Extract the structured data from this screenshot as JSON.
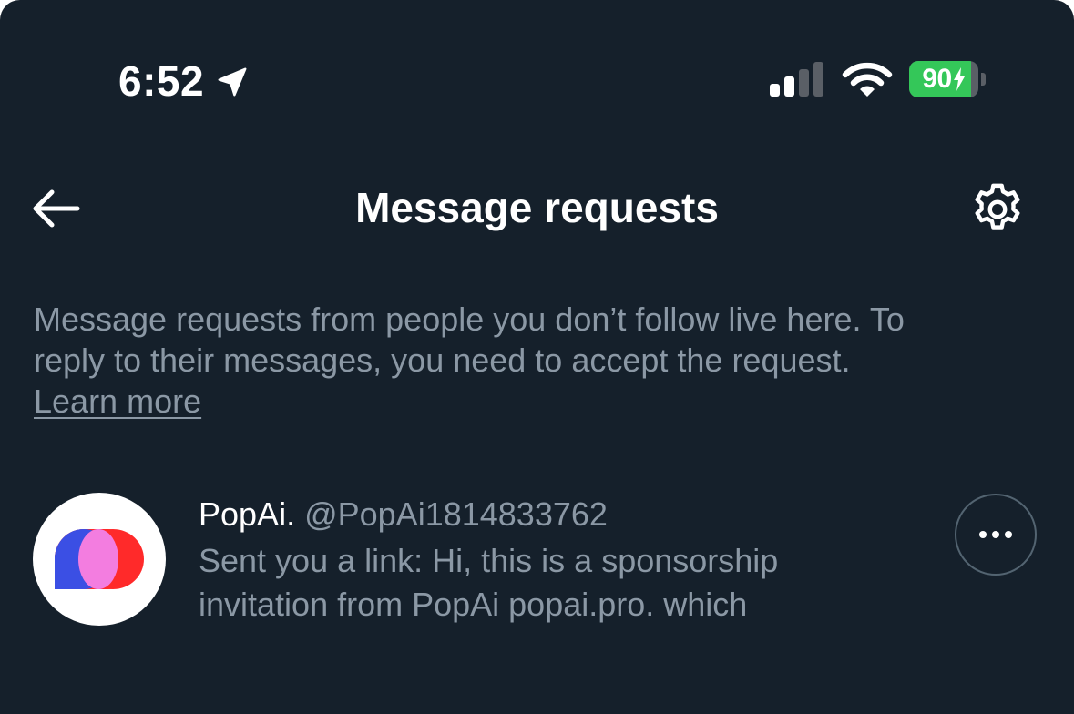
{
  "status_bar": {
    "time": "6:52",
    "battery_percent": "90",
    "battery_level": 0.9,
    "icons": [
      "location-arrow-icon",
      "cellular-signal-icon",
      "wifi-icon",
      "charging-bolt-icon"
    ]
  },
  "header": {
    "title": "Message requests",
    "back_icon": "arrow-left-icon",
    "settings_icon": "gear-icon"
  },
  "info": {
    "line1": "Message requests from people you don’t follow live here. To",
    "line2": "reply to their messages, you need to accept the request.",
    "link": "Learn more"
  },
  "requests": [
    {
      "name": "PopAi.",
      "handle": "@PopAi1814833762",
      "preview_line1": "Sent you a link: Hi, this is a sponsorship",
      "preview_line2": "invitation from PopAi popai.pro. which",
      "more_icon": "ellipsis-icon"
    }
  ],
  "colors": {
    "background": "#15202b",
    "text_primary": "#ffffff",
    "text_secondary": "#8b98a5",
    "battery_green": "#34c759",
    "divider": "#536471"
  }
}
